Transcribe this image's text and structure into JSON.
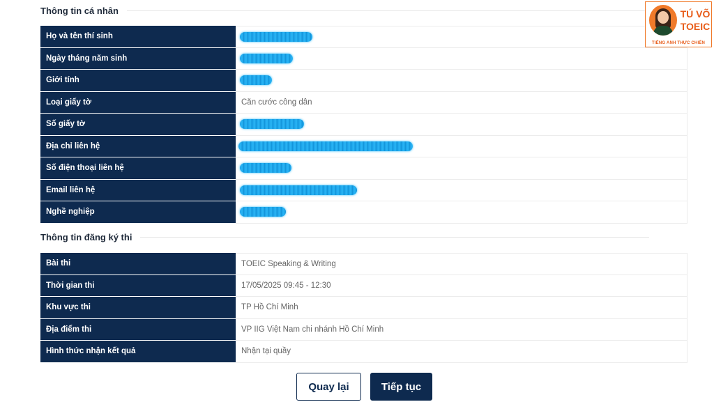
{
  "personal": {
    "title": "Thông tin cá nhân",
    "rows": [
      {
        "label": "Họ và tên thí sinh",
        "value": "",
        "redacted": true
      },
      {
        "label": "Ngày tháng năm sinh",
        "value": "",
        "redacted": true
      },
      {
        "label": "Giới tính",
        "value": "",
        "redacted": true
      },
      {
        "label": "Loại giấy tờ",
        "value": "Căn cước công dân",
        "redacted": false
      },
      {
        "label": "Số giấy tờ",
        "value": "",
        "redacted": true
      },
      {
        "label": "Địa chỉ liên hệ",
        "value": "",
        "redacted": true
      },
      {
        "label": "Số điện thoại liên hệ",
        "value": "",
        "redacted": true
      },
      {
        "label": "Email liên hệ",
        "value": "",
        "redacted": true
      },
      {
        "label": "Nghề nghiệp",
        "value": "",
        "redacted": true
      }
    ]
  },
  "exam": {
    "title": "Thông tin đăng ký thi",
    "rows": [
      {
        "label": "Bài thi",
        "value": "TOEIC Speaking & Writing"
      },
      {
        "label": "Thời gian thi",
        "value": "17/05/2025 09:45 - 12:30"
      },
      {
        "label": "Khu vực thi",
        "value": "TP Hồ Chí Minh"
      },
      {
        "label": "Địa điểm thi",
        "value": "VP IIG Việt Nam chi nhánh Hồ Chí Minh"
      },
      {
        "label": "Hình thức nhận kết quả",
        "value": "Nhận tại quầy"
      }
    ]
  },
  "buttons": {
    "back": "Quay lại",
    "next": "Tiếp tục"
  },
  "logo": {
    "brand_line1": "TÚ VÕ",
    "brand_line2": "TOEIC",
    "tagline": "TIẾNG ANH THỰC CHIẾN",
    "accent": "#e85d1a"
  },
  "colors": {
    "label_bg": "#0e2a4f",
    "redaction": "#1aa0e8"
  }
}
